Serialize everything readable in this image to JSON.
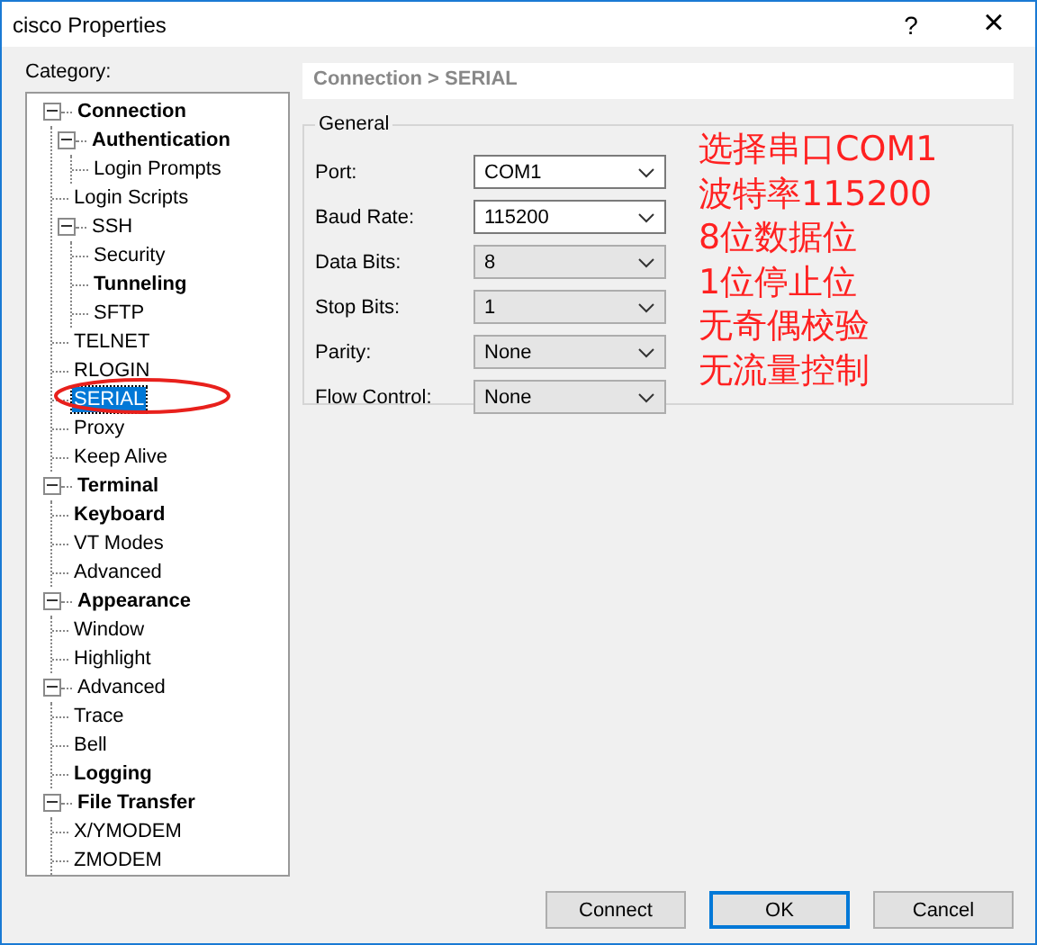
{
  "window": {
    "title": "cisco Properties",
    "help": "?",
    "close": "×"
  },
  "category_label": "Category:",
  "tree": [
    {
      "label": "Connection",
      "bold": true,
      "selected": false,
      "expanded": true,
      "children": [
        {
          "label": "Authentication",
          "bold": true,
          "selected": false,
          "expanded": true,
          "children": [
            {
              "label": "Login Prompts",
              "bold": false,
              "selected": false
            }
          ]
        },
        {
          "label": "Login Scripts",
          "bold": false,
          "selected": false
        },
        {
          "label": "SSH",
          "bold": false,
          "selected": false,
          "expanded": true,
          "children": [
            {
              "label": "Security",
              "bold": false,
              "selected": false
            },
            {
              "label": "Tunneling",
              "bold": true,
              "selected": false
            },
            {
              "label": "SFTP",
              "bold": false,
              "selected": false
            }
          ]
        },
        {
          "label": "TELNET",
          "bold": false,
          "selected": false
        },
        {
          "label": "RLOGIN",
          "bold": false,
          "selected": false
        },
        {
          "label": "SERIAL",
          "bold": false,
          "selected": true
        },
        {
          "label": "Proxy",
          "bold": false,
          "selected": false
        },
        {
          "label": "Keep Alive",
          "bold": false,
          "selected": false
        }
      ]
    },
    {
      "label": "Terminal",
      "bold": true,
      "selected": false,
      "expanded": true,
      "children": [
        {
          "label": "Keyboard",
          "bold": true,
          "selected": false
        },
        {
          "label": "VT Modes",
          "bold": false,
          "selected": false
        },
        {
          "label": "Advanced",
          "bold": false,
          "selected": false
        }
      ]
    },
    {
      "label": "Appearance",
      "bold": true,
      "selected": false,
      "expanded": true,
      "children": [
        {
          "label": "Window",
          "bold": false,
          "selected": false
        },
        {
          "label": "Highlight",
          "bold": false,
          "selected": false
        }
      ]
    },
    {
      "label": "Advanced",
      "bold": false,
      "selected": false,
      "expanded": true,
      "children": [
        {
          "label": "Trace",
          "bold": false,
          "selected": false
        },
        {
          "label": "Bell",
          "bold": false,
          "selected": false
        },
        {
          "label": "Logging",
          "bold": true,
          "selected": false
        }
      ]
    },
    {
      "label": "File Transfer",
      "bold": true,
      "selected": false,
      "expanded": true,
      "children": [
        {
          "label": "X/YMODEM",
          "bold": false,
          "selected": false
        },
        {
          "label": "ZMODEM",
          "bold": false,
          "selected": false
        }
      ]
    }
  ],
  "breadcrumb": "Connection > SERIAL",
  "group": {
    "title": "General",
    "fields": [
      {
        "label": "Port:",
        "value": "COM1",
        "kind": "editable"
      },
      {
        "label": "Baud Rate:",
        "value": "115200",
        "kind": "editable"
      },
      {
        "label": "Data Bits:",
        "value": "8",
        "kind": "list"
      },
      {
        "label": "Stop Bits:",
        "value": "1",
        "kind": "list"
      },
      {
        "label": "Parity:",
        "value": "None",
        "kind": "list"
      },
      {
        "label": "Flow Control:",
        "value": "None",
        "kind": "list"
      }
    ]
  },
  "annotations": [
    "选择串口COM1",
    "波特率115200",
    "8位数据位",
    "1位停止位",
    "无奇偶校验",
    "无流量控制"
  ],
  "buttons": [
    {
      "label": "Connect",
      "default": false
    },
    {
      "label": "OK",
      "default": true
    },
    {
      "label": "Cancel",
      "default": false
    }
  ]
}
